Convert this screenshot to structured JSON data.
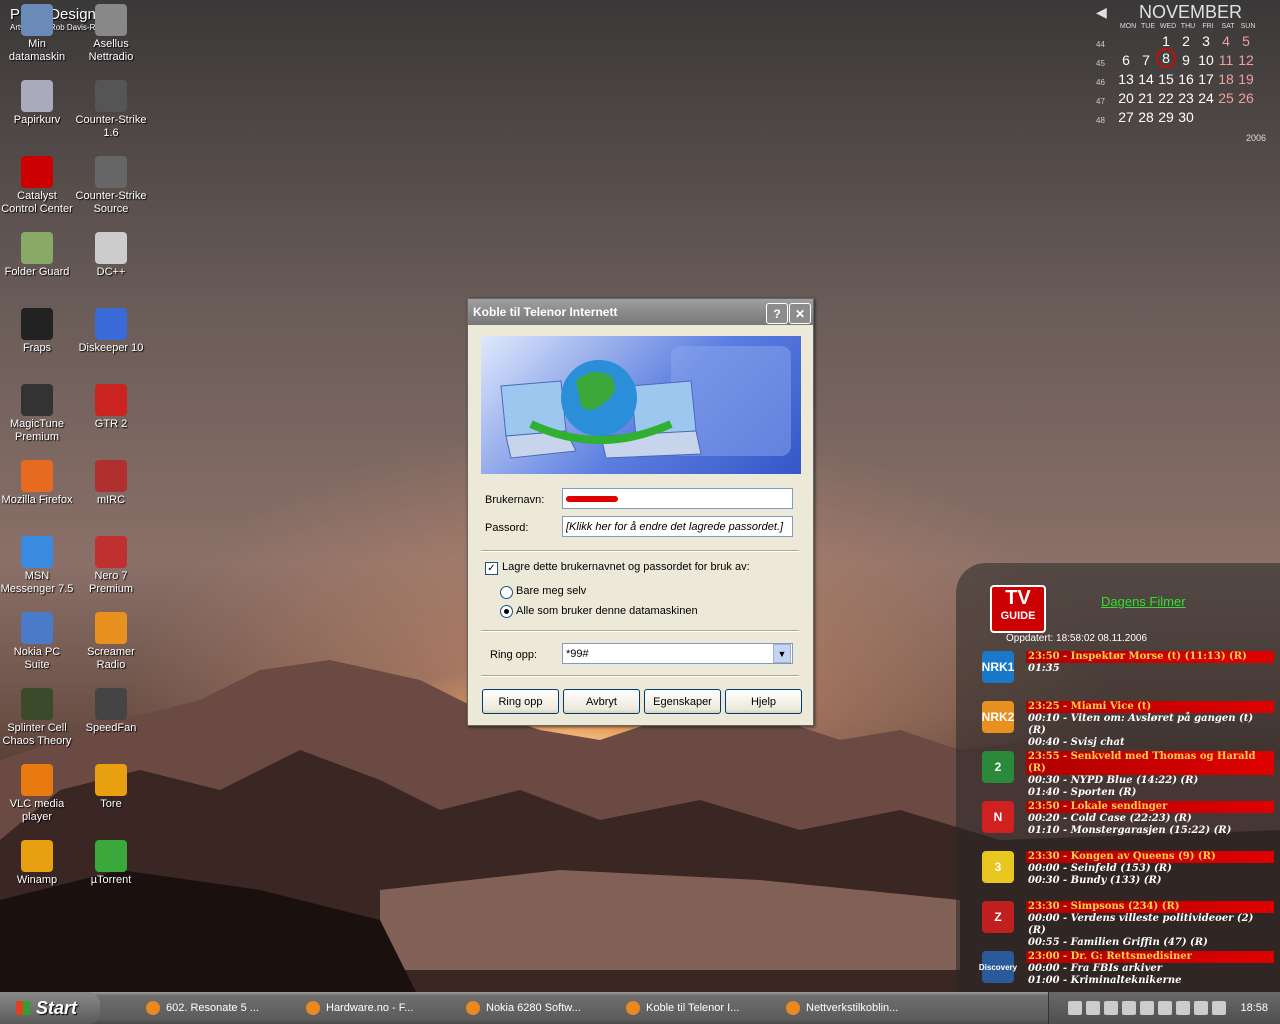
{
  "desktop": {
    "logo_text": "PhotoDesign.uk",
    "logo_sub": "Artwork by Rob Davis-Randtoul",
    "icons": [
      {
        "label": "Min datamaskin",
        "name": "my-computer-icon"
      },
      {
        "label": "Asellus Nettradio",
        "name": "nettradio-icon"
      },
      {
        "label": "Papirkurv",
        "name": "recycle-bin-icon"
      },
      {
        "label": "Counter-Strike 1.6",
        "name": "counter-strike-icon"
      },
      {
        "label": "Catalyst Control Center",
        "name": "ati-catalyst-icon"
      },
      {
        "label": "Counter-Strike Source",
        "name": "counter-strike-source-icon"
      },
      {
        "label": "Folder Guard",
        "name": "folder-guard-icon"
      },
      {
        "label": "DC++",
        "name": "dcpp-icon"
      },
      {
        "label": "Fraps",
        "name": "fraps-icon"
      },
      {
        "label": "Diskeeper 10",
        "name": "diskeeper-icon"
      },
      {
        "label": "MagicTune Premium",
        "name": "magictune-icon"
      },
      {
        "label": "GTR 2",
        "name": "gtr2-icon"
      },
      {
        "label": "Mozilla Firefox",
        "name": "firefox-icon"
      },
      {
        "label": "mIRC",
        "name": "mirc-icon"
      },
      {
        "label": "MSN Messenger 7.5",
        "name": "msn-messenger-icon"
      },
      {
        "label": "Nero 7 Premium",
        "name": "nero-icon"
      },
      {
        "label": "Nokia PC Suite",
        "name": "nokia-pc-suite-icon"
      },
      {
        "label": "Screamer Radio",
        "name": "screamer-radio-icon"
      },
      {
        "label": "Splinter Cell Chaos Theory",
        "name": "splinter-cell-icon"
      },
      {
        "label": "SpeedFan",
        "name": "speedfan-icon"
      },
      {
        "label": "VLC media player",
        "name": "vlc-icon"
      },
      {
        "label": "Tore",
        "name": "winamp-shortcut-icon"
      },
      {
        "label": "Winamp",
        "name": "winamp-icon"
      },
      {
        "label": "µTorrent",
        "name": "utorrent-icon"
      }
    ]
  },
  "calendar": {
    "month": "NOVEMBER",
    "year": "2006",
    "dow": [
      "MON",
      "TUE",
      "WED",
      "THU",
      "FRI",
      "SAT",
      "SUN"
    ],
    "weeks": [
      {
        "wk": "44",
        "days": [
          "",
          "",
          "1",
          "2",
          "3",
          "4",
          "5"
        ]
      },
      {
        "wk": "45",
        "days": [
          "6",
          "7",
          "8",
          "9",
          "10",
          "11",
          "12"
        ]
      },
      {
        "wk": "46",
        "days": [
          "13",
          "14",
          "15",
          "16",
          "17",
          "18",
          "19"
        ]
      },
      {
        "wk": "47",
        "days": [
          "20",
          "21",
          "22",
          "23",
          "24",
          "25",
          "26"
        ]
      },
      {
        "wk": "48",
        "days": [
          "27",
          "28",
          "29",
          "30",
          "",
          "",
          ""
        ]
      }
    ],
    "today": "8"
  },
  "dialog": {
    "title": "Koble til Telenor Internett",
    "help_btn": "?",
    "close_btn": "✕",
    "username_label": "Brukernavn:",
    "username_value": "",
    "password_label": "Passord:",
    "password_value": "[Klikk her for å endre det lagrede passordet.]",
    "save_label": "Lagre dette brukernavnet og passordet for bruk av:",
    "radio_me": "Bare meg selv",
    "radio_all": "Alle som bruker denne datamaskinen",
    "dial_label": "Ring opp:",
    "dial_value": "*99#",
    "buttons": {
      "dial": "Ring opp",
      "cancel": "Avbryt",
      "properties": "Egenskaper",
      "help": "Hjelp"
    }
  },
  "tvguide": {
    "logo_top": "TV",
    "logo_bottom": "GUIDE",
    "link": "Dagens Filmer",
    "updated": "Oppdatert: 18:58:02 08.11.2006",
    "channels": [
      {
        "ch": "NRK1",
        "color": "#1a78c8",
        "lines": [
          "23:50 - Inspektør Morse (t) (11:13) (R)",
          "01:35"
        ]
      },
      {
        "ch": "NRK2",
        "color": "#e89020",
        "lines": [
          "23:25 - Miami Vice (t)",
          "00:10 - Viten om: Avsløret på gangen (t) (R)",
          "00:40 - Svisj chat"
        ]
      },
      {
        "ch": "2",
        "color": "#2a8a3a",
        "lines": [
          "23:55 - Senkveld med Thomas og Harald (R)",
          "00:30 - NYPD Blue (14:22) (R)",
          "01:40 - Sporten (R)"
        ]
      },
      {
        "ch": "N",
        "color": "#d02020",
        "lines": [
          "23:50 - Lokale sendinger",
          "00:20 - Cold Case (22:23) (R)",
          "01:10 - Monstergarasjen (15:22) (R)"
        ]
      },
      {
        "ch": "3",
        "color": "#e8c820",
        "lines": [
          "23:30 - Kongen av Queens (9) (R)",
          "00:00 - Seinfeld (153) (R)",
          "00:30 - Bundy (133) (R)"
        ]
      },
      {
        "ch": "Z",
        "color": "#c02020",
        "lines": [
          "23:30 - Simpsons (234) (R)",
          "00:00 - Verdens villeste politivideoer (2) (R)",
          "00:55 - Familien Griffin (47) (R)"
        ]
      },
      {
        "ch": "Discovery",
        "color": "#2a5a9a",
        "lines": [
          "23:00 - Dr. G: Rettsmedisiner",
          "00:00 - Fra FBIs arkiver",
          "01:00 - Kriminalteknikerne"
        ]
      }
    ]
  },
  "taskbar": {
    "start": "Start",
    "tasks": [
      "602. Resonate 5 ...",
      "Hardware.no - F...",
      "Nokia 6280 Softw...",
      "Koble til Telenor I...",
      "Nettverkstilkoblin..."
    ],
    "clock": "18:58"
  }
}
